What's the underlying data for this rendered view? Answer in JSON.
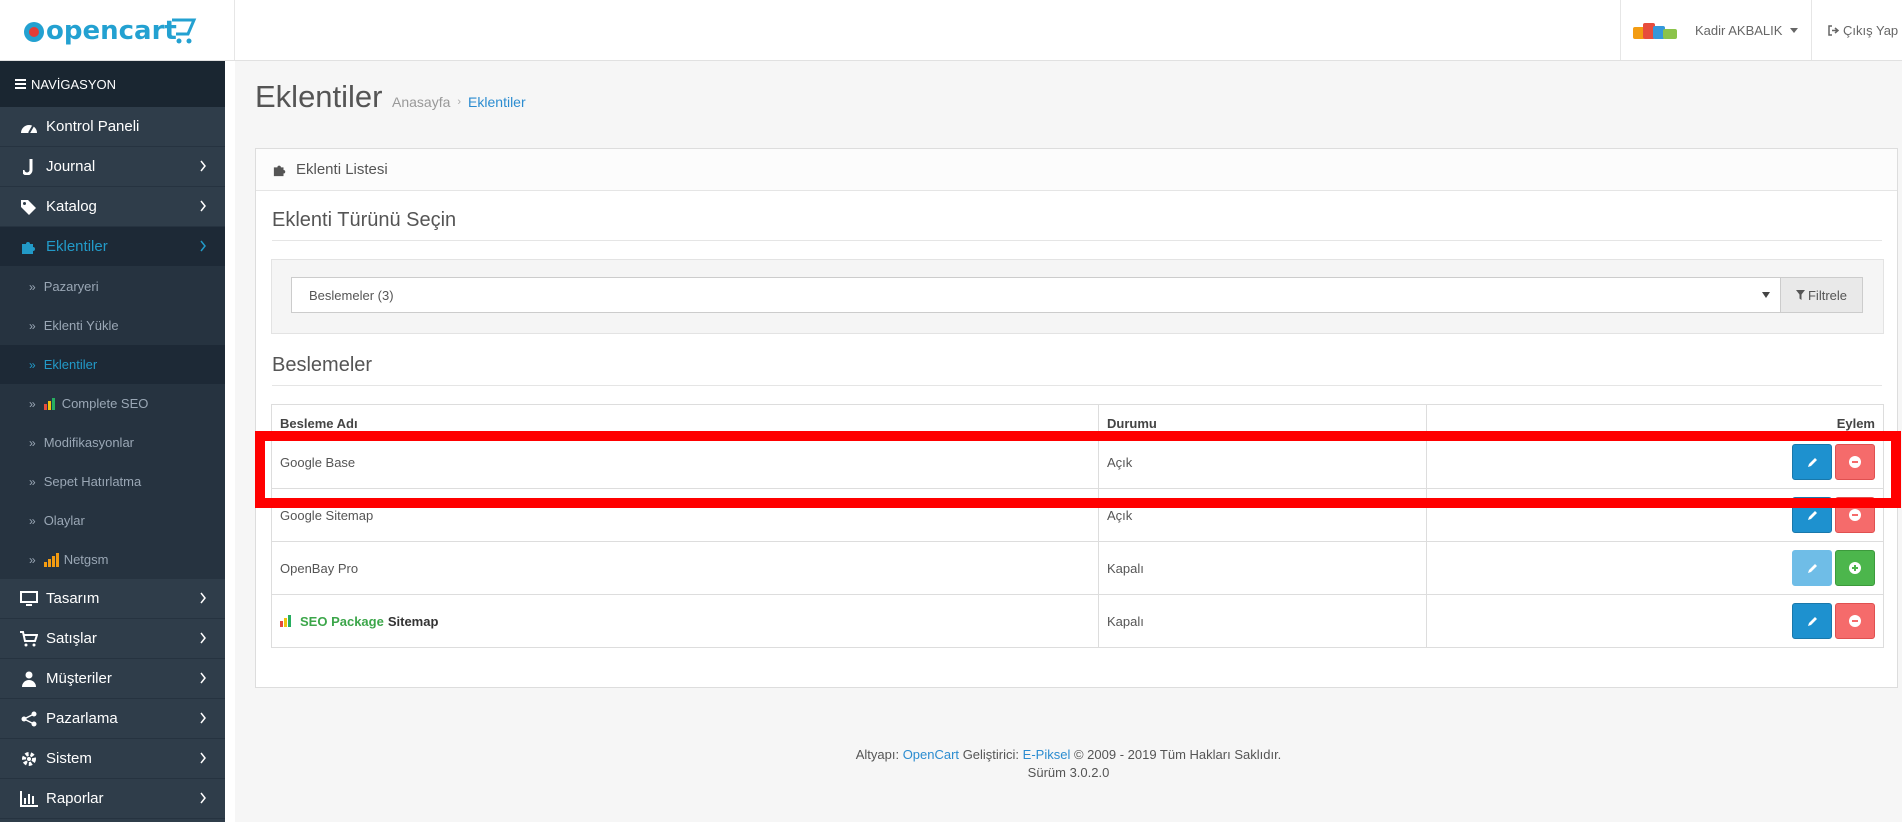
{
  "header": {
    "logo_text": "opencart",
    "user_name": "Kadir AKBALIK",
    "logout_label": "Çıkış Yap"
  },
  "sidebar": {
    "nav_title": "NAVİGASYON",
    "items": [
      {
        "label": "Kontrol Paneli",
        "icon": "dashboard-icon"
      },
      {
        "label": "Journal",
        "icon": "journal-icon"
      },
      {
        "label": "Katalog",
        "icon": "tags-icon"
      },
      {
        "label": "Eklentiler",
        "icon": "puzzle-icon"
      },
      {
        "label": "Tasarım",
        "icon": "monitor-icon"
      },
      {
        "label": "Satışlar",
        "icon": "cart-icon"
      },
      {
        "label": "Müşteriler",
        "icon": "user-icon"
      },
      {
        "label": "Pazarlama",
        "icon": "share-icon"
      },
      {
        "label": "Sistem",
        "icon": "gear-icon"
      },
      {
        "label": "Raporlar",
        "icon": "bar-chart-icon"
      }
    ],
    "sub_items": [
      {
        "label": "Pazaryeri"
      },
      {
        "label": "Eklenti Yükle"
      },
      {
        "label": "Eklentiler"
      },
      {
        "label": "Complete SEO"
      },
      {
        "label": "Modifikasyonlar"
      },
      {
        "label": "Sepet Hatırlatma"
      },
      {
        "label": "Olaylar"
      },
      {
        "label": "Netgsm"
      }
    ]
  },
  "page": {
    "title": "Eklentiler",
    "breadcrumb": [
      "Anasayfa",
      "Eklentiler"
    ]
  },
  "panel": {
    "heading": "Eklenti Listesi",
    "type_title": "Eklenti Türünü Seçin",
    "select_value": "Beslemeler (3)",
    "filter_label": "Filtrele",
    "section_title": "Beslemeler"
  },
  "table": {
    "headers": [
      "Besleme Adı",
      "Durumu",
      "Eylem"
    ],
    "rows": [
      {
        "name": "Google Base",
        "status": "Açık"
      },
      {
        "name": "Google Sitemap",
        "status": "Açık"
      },
      {
        "name": "OpenBay Pro",
        "status": "Kapalı"
      },
      {
        "name_green": "SEO Package",
        "name_black": "Sitemap",
        "status": "Kapalı"
      }
    ]
  },
  "footer": {
    "prefix": "Altyapı:",
    "opencart_link": "OpenCart",
    "dev_label": "Geliştirici:",
    "dev_link": "E-Piksel",
    "copyright": "© 2009 - 2019 Tüm Hakları Saklıdır.",
    "version": "Sürüm 3.0.2.0"
  },
  "colors": {
    "accent": "#229ac8",
    "sidebar_bg": "#2f3d4a",
    "highlight": "#ff0000"
  }
}
